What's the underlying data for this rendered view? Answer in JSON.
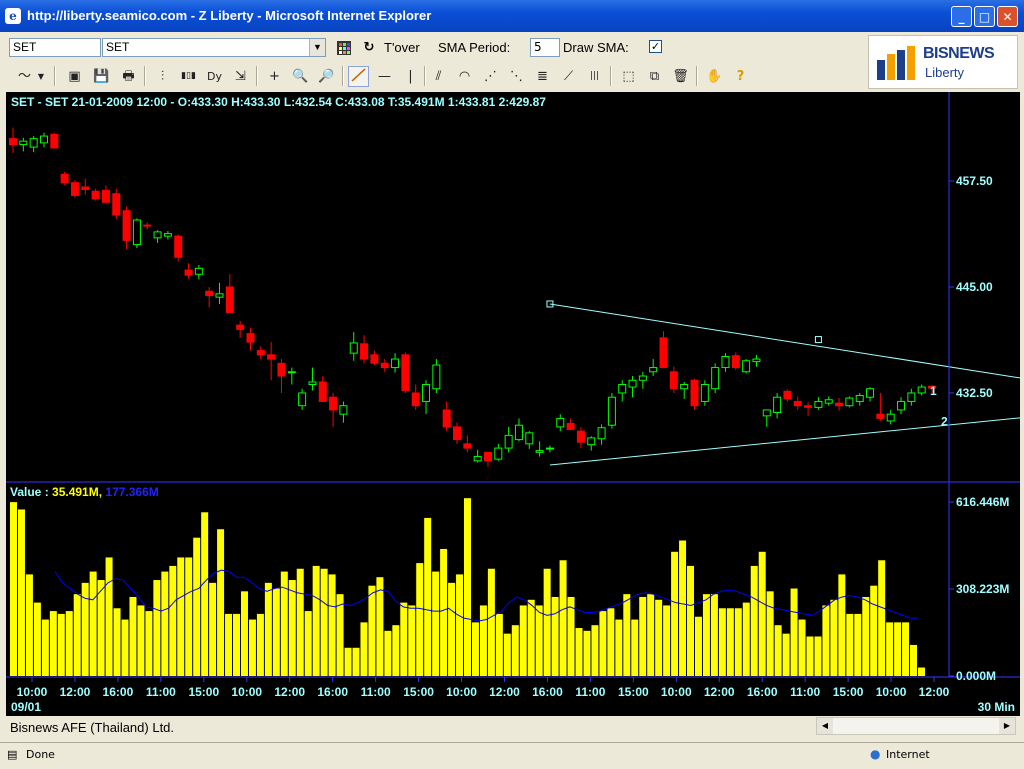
{
  "window": {
    "title": "http://liberty.seamico.com - Z Liberty - Microsoft Internet Explorer",
    "minimize": "_",
    "maximize": "□",
    "close": "✕"
  },
  "toolbar": {
    "symbol_value": "SET",
    "symbol_select_value": "SET",
    "tover_label": "T'over",
    "sma_period_label": "SMA Period:",
    "sma_period_value": "5",
    "draw_sma_label": "Draw SMA:",
    "draw_sma_checked": "✓"
  },
  "logo": {
    "brand": "BISNEWS",
    "sub": "Liberty"
  },
  "chart_data": {
    "type": "candlestick",
    "header": "SET - SET 21-01-2009 12:00 - O:433.30 H:433.30 L:432.54 C:433.08 T:35.491M 1:433.81 2:429.87",
    "price_ticks": [
      "457.50",
      "445.00",
      "432.50"
    ],
    "trendline_labels": [
      "1",
      "2"
    ],
    "candles": [
      [
        462.5,
        463.8,
        460.8,
        461.8
      ],
      [
        461.8,
        462.6,
        461.0,
        462.2
      ],
      [
        461.5,
        462.8,
        460.9,
        462.5
      ],
      [
        462.0,
        463.2,
        461.5,
        462.8
      ],
      [
        463.0,
        463.2,
        461.5,
        461.4
      ],
      [
        458.3,
        458.6,
        457.0,
        457.3
      ],
      [
        457.3,
        457.6,
        455.5,
        455.8
      ],
      [
        456.8,
        457.8,
        455.9,
        456.5
      ],
      [
        456.3,
        456.6,
        455.2,
        455.4
      ],
      [
        456.4,
        457.0,
        454.8,
        455.0
      ],
      [
        456.0,
        456.6,
        453.0,
        453.5
      ],
      [
        454.0,
        454.5,
        449.5,
        450.5
      ],
      [
        450.0,
        453.1,
        449.6,
        452.9
      ],
      [
        452.3,
        452.6,
        451.8,
        452.2
      ],
      [
        450.8,
        451.7,
        450.2,
        451.5
      ],
      [
        451.0,
        451.6,
        450.6,
        451.3
      ],
      [
        451.0,
        451.2,
        448.0,
        448.5
      ],
      [
        447.0,
        447.8,
        446.0,
        446.4
      ],
      [
        446.5,
        447.6,
        445.9,
        447.2
      ],
      [
        444.5,
        445.0,
        442.6,
        444.0
      ],
      [
        443.8,
        445.5,
        443.0,
        444.2
      ],
      [
        445.0,
        446.5,
        442.0,
        442.0
      ],
      [
        440.5,
        441.0,
        439.0,
        440.0
      ],
      [
        439.5,
        440.2,
        437.5,
        438.5
      ],
      [
        437.5,
        438.0,
        436.5,
        437.0
      ],
      [
        437.0,
        438.5,
        434.0,
        436.5
      ],
      [
        436.0,
        436.5,
        432.5,
        434.5
      ],
      [
        435.0,
        435.5,
        433.5,
        435.0
      ],
      [
        431.0,
        433.0,
        430.5,
        432.5
      ],
      [
        433.5,
        435.5,
        432.8,
        433.8
      ],
      [
        433.8,
        434.5,
        431.5,
        431.5
      ],
      [
        432.0,
        432.5,
        428.5,
        430.5
      ],
      [
        430.0,
        431.5,
        429.0,
        431.0
      ],
      [
        437.2,
        439.7,
        436.3,
        438.4
      ],
      [
        438.3,
        439.3,
        436.0,
        436.5
      ],
      [
        437.0,
        437.5,
        435.8,
        436.0
      ],
      [
        436.0,
        436.5,
        435.0,
        435.5
      ],
      [
        435.5,
        437.2,
        434.9,
        436.5
      ],
      [
        437.0,
        437.3,
        432.5,
        432.8
      ],
      [
        432.5,
        433.5,
        430.5,
        431.0
      ],
      [
        431.5,
        434.0,
        430.0,
        433.5
      ],
      [
        433.0,
        436.5,
        432.5,
        435.8
      ],
      [
        430.5,
        431.5,
        428.0,
        428.5
      ],
      [
        428.5,
        429.0,
        426.5,
        427.0
      ],
      [
        426.5,
        427.5,
        425.5,
        426.0
      ],
      [
        424.5,
        425.8,
        424.3,
        425.0
      ],
      [
        425.5,
        424.8,
        423.8,
        424.5
      ],
      [
        424.7,
        426.5,
        424.5,
        426.0
      ],
      [
        426.0,
        428.5,
        425.5,
        427.5
      ],
      [
        427.0,
        429.5,
        426.8,
        428.7
      ],
      [
        426.5,
        428.0,
        425.9,
        427.8
      ],
      [
        425.5,
        426.8,
        425.0,
        425.7
      ],
      [
        426.0,
        426.3,
        425.5,
        426.0
      ],
      [
        428.5,
        430.0,
        428.0,
        429.5
      ],
      [
        428.9,
        429.5,
        428.1,
        428.2
      ],
      [
        428.0,
        428.5,
        426.0,
        426.7
      ],
      [
        426.4,
        427.4,
        425.7,
        427.2
      ],
      [
        427.1,
        428.8,
        426.4,
        428.4
      ],
      [
        428.7,
        432.5,
        428.3,
        432.0
      ],
      [
        432.5,
        434.0,
        431.5,
        433.5
      ],
      [
        433.2,
        434.5,
        432.0,
        434.0
      ],
      [
        434.0,
        435.0,
        433.0,
        434.5
      ],
      [
        435.0,
        436.5,
        434.5,
        435.5
      ],
      [
        439.0,
        439.8,
        435.5,
        435.5
      ],
      [
        435.0,
        435.6,
        432.5,
        433.0
      ],
      [
        433.0,
        433.8,
        431.8,
        433.5
      ],
      [
        434.0,
        434.2,
        430.5,
        431.0
      ],
      [
        431.5,
        434.0,
        431.0,
        433.5
      ],
      [
        433.0,
        436.0,
        432.5,
        435.5
      ],
      [
        435.5,
        437.2,
        435.0,
        436.8
      ],
      [
        436.9,
        437.3,
        435.2,
        435.5
      ],
      [
        435.0,
        436.5,
        434.8,
        436.3
      ],
      [
        436.2,
        437.0,
        435.6,
        436.5
      ],
      [
        429.8,
        430.5,
        428.5,
        430.5
      ],
      [
        430.2,
        432.5,
        429.5,
        432.0
      ],
      [
        432.7,
        432.9,
        431.5,
        431.8
      ],
      [
        431.5,
        432.1,
        430.5,
        431.0
      ],
      [
        431.0,
        431.4,
        429.8,
        430.8
      ],
      [
        430.8,
        432.0,
        430.5,
        431.5
      ],
      [
        431.3,
        432.1,
        431.0,
        431.7
      ],
      [
        431.3,
        431.9,
        430.4,
        431.0
      ],
      [
        431.0,
        432.1,
        430.8,
        431.9
      ],
      [
        431.5,
        432.5,
        431.0,
        432.2
      ],
      [
        432.0,
        433.2,
        431.5,
        433.0
      ],
      [
        430.0,
        432.5,
        429.2,
        429.5
      ],
      [
        429.2,
        430.5,
        428.8,
        430.0
      ],
      [
        430.5,
        432.0,
        430.0,
        431.5
      ],
      [
        431.5,
        433.0,
        431.0,
        432.5
      ],
      [
        432.5,
        433.5,
        432.2,
        433.2
      ],
      [
        433.3,
        433.4,
        432.5,
        433.08
      ]
    ],
    "trendline_1": {
      "from": [
        52,
        443.0
      ],
      "mid": [
        78,
        438.8
      ],
      "to": [
        100,
        433.8
      ]
    },
    "trendline_2": {
      "from": [
        52,
        424.0
      ],
      "to": [
        100,
        429.87
      ]
    },
    "volume_label": "Value : ",
    "volume_value": "35.491M",
    "volume_sma": "177.366M",
    "volume_ticks": [
      "616.446M",
      "308.223M",
      "0.000M"
    ],
    "volume": [
      616,
      590,
      360,
      260,
      200,
      230,
      220,
      230,
      290,
      330,
      370,
      340,
      420,
      240,
      200,
      280,
      250,
      230,
      340,
      370,
      390,
      420,
      420,
      490,
      580,
      330,
      520,
      220,
      220,
      300,
      200,
      220,
      330,
      310,
      370,
      340,
      380,
      230,
      390,
      380,
      360,
      290,
      100,
      100,
      190,
      320,
      350,
      160,
      180,
      260,
      250,
      400,
      560,
      370,
      450,
      330,
      360,
      630,
      190,
      250,
      380,
      220,
      150,
      180,
      250,
      270,
      250,
      380,
      280,
      410,
      280,
      170,
      160,
      180,
      230,
      240,
      200,
      290,
      200,
      280,
      290,
      270,
      250,
      440,
      480,
      390,
      210,
      290,
      290,
      240,
      240,
      240,
      260,
      390,
      440,
      300,
      180,
      150,
      310,
      200,
      140,
      140,
      250,
      270,
      360,
      220,
      220,
      280,
      320,
      410,
      190,
      190,
      190,
      110,
      30
    ],
    "volume_sma_line": [
      370,
      330,
      310,
      290,
      275,
      270,
      300,
      330,
      345,
      340,
      310,
      280,
      245,
      240,
      230,
      240,
      270,
      285,
      300,
      310,
      340,
      365,
      375,
      370,
      350,
      350,
      330,
      310,
      300,
      310,
      315,
      305,
      295,
      290,
      285,
      270,
      250,
      245,
      255,
      250,
      260,
      275,
      295,
      305,
      300,
      265,
      245,
      240,
      240,
      235,
      230,
      230,
      240,
      220,
      205,
      200,
      195,
      200,
      215,
      230,
      260,
      280,
      270,
      250,
      225,
      215,
      220,
      235,
      245,
      235,
      225,
      225,
      230,
      240,
      250,
      260,
      275,
      290,
      295,
      290,
      280,
      270,
      260,
      255,
      250,
      260,
      270,
      290,
      300,
      305,
      300,
      290,
      280,
      265,
      250,
      240,
      235,
      230,
      225,
      220,
      215,
      230,
      250,
      270,
      280,
      285,
      280,
      270,
      255,
      245,
      235,
      225,
      215,
      205,
      205
    ],
    "time_labels": [
      "10:00",
      "12:00",
      "16:00",
      "11:00",
      "15:00",
      "10:00",
      "12:00",
      "16:00",
      "11:00",
      "15:00",
      "10:00",
      "12:00",
      "16:00",
      "11:00",
      "15:00",
      "10:00",
      "12:00",
      "16:00",
      "11:00",
      "15:00",
      "10:00",
      "12:00"
    ],
    "date_label": "09/01",
    "interval_label": "30 Min"
  },
  "footer": {
    "company": "Bisnews AFE (Thailand) Ltd."
  },
  "status": {
    "done": "Done",
    "zone": "Internet"
  },
  "colors": {
    "up": "#00ff00",
    "down": "#ff0000",
    "volume": "#ffff00",
    "sma": "#0000ff",
    "trend": "#a0ffff",
    "header": "#a0ffff",
    "axis": "#3333ff"
  }
}
